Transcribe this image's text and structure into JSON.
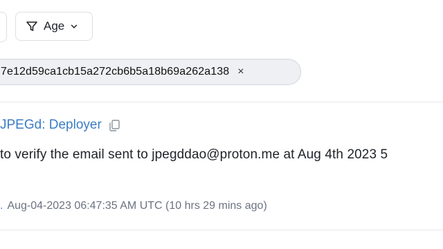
{
  "toolbar": {
    "filter_label": "Age",
    "filter_icon": "filter-icon",
    "dropdown_icon": "chevron-down-icon"
  },
  "chip": {
    "text": "7e12d59ca1cb15a272cb6b5a18b69a262a138",
    "close": "×"
  },
  "entry": {
    "link": "JPEGd: Deployer",
    "copy_icon": "copy-icon",
    "message": "to verify the email sent to jpegddao@proton.me at Aug 4th 2023 5",
    "meta_prefix": ".",
    "timestamp": "Aug-04-2023 06:47:35 AM UTC (10 hrs 29 mins ago)"
  },
  "colors": {
    "accent": "#3b7dc4",
    "muted": "#6b7280",
    "border": "#dcdfe4"
  }
}
